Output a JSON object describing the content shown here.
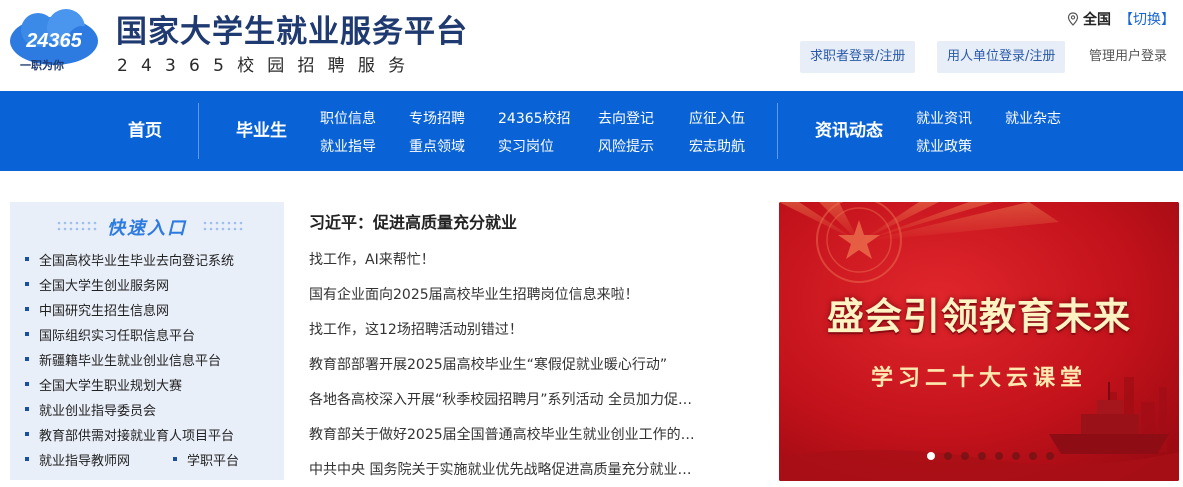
{
  "header": {
    "logo_number": "24365",
    "logo_slogan": "一职为你",
    "title": "国家大学生就业服务平台",
    "subtitle": "24365校园招聘服务",
    "region": "全国",
    "region_switch": "【切换】",
    "login_seeker": "求职者登录/注册",
    "login_employer": "用人单位登录/注册",
    "login_admin": "管理用户登录"
  },
  "nav": {
    "home": "首页",
    "graduates": "毕业生",
    "graduate_links": [
      "职位信息",
      "专场招聘",
      "24365校招",
      "去向登记",
      "应征入伍",
      "就业指导",
      "重点领域",
      "实习岗位",
      "风险提示",
      "宏志助航"
    ],
    "news": "资讯动态",
    "news_links": [
      "就业资讯",
      "就业杂志",
      "就业政策"
    ]
  },
  "quick_entry": {
    "title": "快速入口",
    "items": [
      "全国高校毕业生毕业去向登记系统",
      "全国大学生创业服务网",
      "中国研究生招生信息网",
      "国际组织实习任职信息平台",
      "新疆籍毕业生就业创业信息平台",
      "全国大学生职业规划大赛",
      "就业创业指导委员会",
      "教育部供需对接就业育人项目平台",
      "就业指导教师网",
      "学职平台"
    ]
  },
  "news": {
    "headline": "习近平：促进高质量充分就业",
    "items": [
      "找工作，AI来帮忙！",
      "国有企业面向2025届高校毕业生招聘岗位信息来啦！",
      "找工作，这12场招聘活动别错过！",
      "教育部部署开展2025届高校毕业生“寒假促就业暖心行动”",
      "各地各高校深入开展“秋季校园招聘月”系列活动 全员加力促…",
      "教育部关于做好2025届全国普通高校毕业生就业创业工作的…",
      "中共中央 国务院关于实施就业优先战略促进高质量充分就业…"
    ]
  },
  "banner": {
    "title": "盛会引领教育未来",
    "subtitle": "学习二十大云课堂",
    "slide_count": 8,
    "active_slide": 1
  },
  "colors": {
    "nav_blue": "#0a63d6",
    "title_navy": "#1f3a70",
    "banner_red": "#c4141d",
    "quick_bg": "#e9eff9"
  }
}
